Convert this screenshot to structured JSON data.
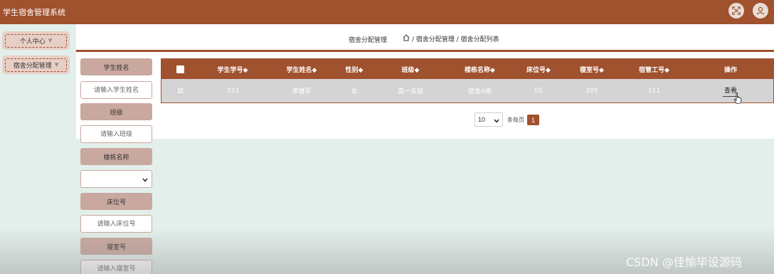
{
  "app": {
    "title": "学生宿舍管理系统"
  },
  "topbar_icons": {
    "fullscreen": "fullscreen-icon",
    "user": "user-icon"
  },
  "nav": {
    "items": [
      {
        "label": "个人中心"
      },
      {
        "label": "宿舍分配管理"
      }
    ]
  },
  "breadcrumb": {
    "page_title": "宿舍分配管理",
    "home_icon": "home-icon",
    "path": "/ 宿舍分配管理 / 宿舍分配列表"
  },
  "filters": {
    "student_name": {
      "label": "学生姓名",
      "placeholder": "请输入学生姓名"
    },
    "class": {
      "label": "班级",
      "placeholder": "请输入班级"
    },
    "building": {
      "label": "楼栋名称",
      "value": ""
    },
    "bed": {
      "label": "床位号",
      "placeholder": "请输入床位号"
    },
    "room": {
      "label": "寝室号",
      "placeholder": "请输入寝室号"
    }
  },
  "table": {
    "headers": [
      "学生学号◆",
      "学生姓名◆",
      "性别◆",
      "班级◆",
      "楼栋名称◆",
      "床位号◆",
      "寝室号◆",
      "宿管工号◆",
      "操作"
    ],
    "rows": [
      {
        "cells": [
          "333",
          "李雄军",
          "女",
          "高一五班",
          "宿舍A栋",
          "05",
          "205",
          "111"
        ],
        "action": "查看"
      }
    ]
  },
  "pagination": {
    "page_size": "10",
    "per_page_label": "条每页",
    "current_page": "1"
  },
  "watermark": "CSDN @佳愉毕设源码",
  "colors": {
    "brand": "#a0512d",
    "label_bg": "#c9a89f",
    "nav_bg": "#e8cfc6",
    "page_bg": "#e3efea"
  }
}
